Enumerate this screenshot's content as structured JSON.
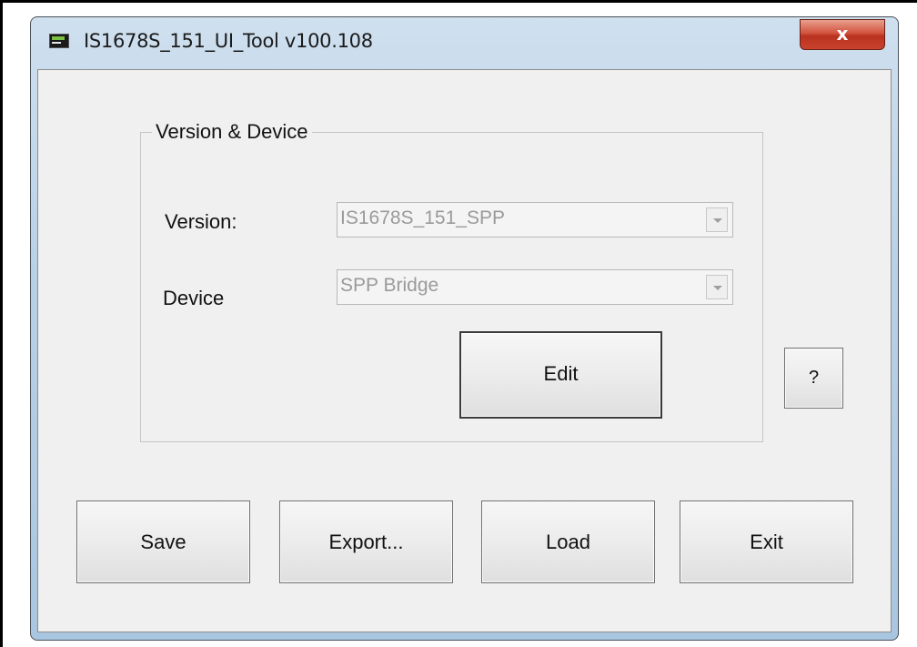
{
  "window": {
    "title": "IS1678S_151_UI_Tool v100.108",
    "close_label": "x"
  },
  "group": {
    "legend": "Version & Device",
    "version_label": "Version:",
    "version_value": "IS1678S_151_SPP",
    "device_label": "Device",
    "device_value": "SPP Bridge",
    "edit_label": "Edit"
  },
  "help_label": "?",
  "actions": {
    "save_label": "Save",
    "export_label": "Export...",
    "load_label": "Load",
    "exit_label": "Exit"
  },
  "colors": {
    "titlebar": "#b9d1e7",
    "close_button": "#c8422c",
    "client_background": "#f0f0f0",
    "disabled_text": "#9a9a9a"
  },
  "icons": {
    "app": "app-icon",
    "close": "close-icon",
    "dropdown": "chevron-down-icon"
  }
}
